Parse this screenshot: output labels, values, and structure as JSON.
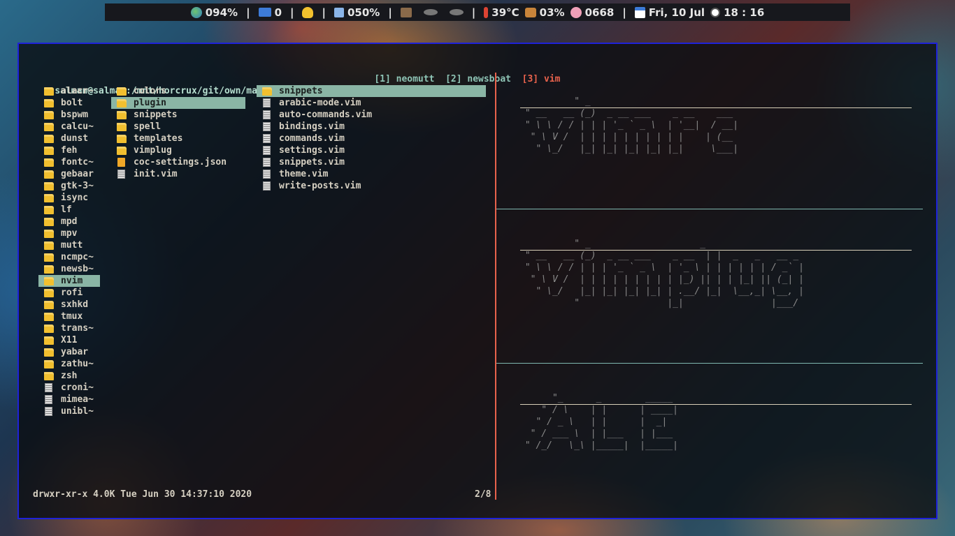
{
  "topbar": {
    "items": [
      {
        "icon": "globe-icon",
        "text": "094%"
      },
      {
        "icon": "mail-icon",
        "text": "0"
      },
      {
        "icon": "bell-icon",
        "text": ""
      },
      {
        "icon": "volume-icon",
        "text": "050%"
      },
      {
        "icon": "house-icon",
        "text": ""
      },
      {
        "icon": "temperature-icon",
        "text": "39°C"
      },
      {
        "icon": "horse-icon",
        "text": "03%"
      },
      {
        "icon": "brain-icon",
        "text": "0668"
      },
      {
        "icon": "calendar-icon",
        "text": "Fri, 10 Jul"
      },
      {
        "icon": "clock-icon",
        "text": "18 : 16"
      }
    ],
    "separator": "|"
  },
  "tmux": {
    "tabs": [
      {
        "label": "[1] neomutt",
        "active": false
      },
      {
        "label": "[2] newsboat",
        "active": false
      },
      {
        "label": "[3] vim",
        "active": true
      }
    ]
  },
  "path": {
    "prefix": "salman@salman:/mnt/horcrux/git/own/magpie/.config/nvim/",
    "current": "plugin"
  },
  "columns": {
    "parent": [
      {
        "name": "alacr~",
        "type": "folder"
      },
      {
        "name": "bolt",
        "type": "folder"
      },
      {
        "name": "bspwm",
        "type": "folder"
      },
      {
        "name": "calcu~",
        "type": "folder"
      },
      {
        "name": "dunst",
        "type": "folder"
      },
      {
        "name": "feh",
        "type": "folder"
      },
      {
        "name": "fontc~",
        "type": "folder"
      },
      {
        "name": "gebaar",
        "type": "folder"
      },
      {
        "name": "gtk-3~",
        "type": "folder"
      },
      {
        "name": "isync",
        "type": "folder"
      },
      {
        "name": "lf",
        "type": "folder"
      },
      {
        "name": "mpd",
        "type": "folder"
      },
      {
        "name": "mpv",
        "type": "folder"
      },
      {
        "name": "mutt",
        "type": "folder"
      },
      {
        "name": "ncmpc~",
        "type": "folder"
      },
      {
        "name": "newsb~",
        "type": "folder"
      },
      {
        "name": "nvim",
        "type": "folder",
        "selected": true
      },
      {
        "name": "rofi",
        "type": "folder"
      },
      {
        "name": "sxhkd",
        "type": "folder"
      },
      {
        "name": "tmux",
        "type": "folder"
      },
      {
        "name": "trans~",
        "type": "folder"
      },
      {
        "name": "X11",
        "type": "folder"
      },
      {
        "name": "yabar",
        "type": "folder"
      },
      {
        "name": "zathu~",
        "type": "folder"
      },
      {
        "name": "zsh",
        "type": "folder"
      },
      {
        "name": "croni~",
        "type": "file"
      },
      {
        "name": "mimea~",
        "type": "file"
      },
      {
        "name": "unibl~",
        "type": "file"
      }
    ],
    "current": [
      {
        "name": "colors",
        "type": "folder"
      },
      {
        "name": "plugin",
        "type": "folder",
        "selected": true
      },
      {
        "name": "snippets",
        "type": "folder"
      },
      {
        "name": "spell",
        "type": "folder"
      },
      {
        "name": "templates",
        "type": "folder"
      },
      {
        "name": "vimplug",
        "type": "folder"
      },
      {
        "name": "coc-settings.json",
        "type": "json"
      },
      {
        "name": "init.vim",
        "type": "file"
      }
    ],
    "child": [
      {
        "name": "snippets",
        "type": "folder",
        "selected": true
      },
      {
        "name": "arabic-mode.vim",
        "type": "file"
      },
      {
        "name": "auto-commands.vim",
        "type": "file"
      },
      {
        "name": "bindings.vim",
        "type": "file"
      },
      {
        "name": "commands.vim",
        "type": "file"
      },
      {
        "name": "settings.vim",
        "type": "file"
      },
      {
        "name": "snippets.vim",
        "type": "file"
      },
      {
        "name": "theme.vim",
        "type": "file"
      },
      {
        "name": "write-posts.vim",
        "type": "file"
      }
    ]
  },
  "preview": {
    "block1": "          \" _\n \" __   __ (_)  _ __ ___    _ __    ___\n \" \\ \\ / / | | | '_ ` _ \\  | '__|  / __|\n  \" \\ V /  | | | | | | | | | |    | (__\n   \" \\_/   |_| |_| |_| |_| |_|     \\___|",
    "block2": "          \" _                    _\n \" __   __ (_)  _ __ ___    _ __  | |  _   _   __ _\n \" \\ \\ / / | | | '_ ` _ \\  | '_ \\ | | | | | | / _` |\n  \" \\ V /  | | | | | | | | | |_) || | | |_| || (_| |\n   \" \\_/   |_| |_| |_| |_| | .__/ |_|  \\__,_| \\__, |\n          \"                |_|                |___/",
    "block3": "      \"_      _        _____\n    \" / \\    | |      | ____|\n   \" / _ \\   | |      |  _|\n  \" / ___ \\  | |___   | |___\n \" /_/   \\_\\ |_____|  |_____|"
  },
  "status": {
    "info": "drwxr-xr-x 4.0K Tue Jun 30 14:37:10 2020",
    "position": "2/8"
  }
}
